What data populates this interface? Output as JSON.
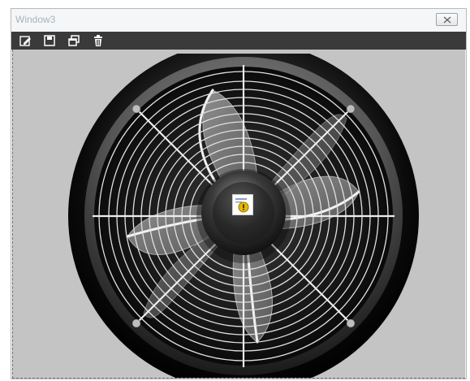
{
  "window": {
    "title": "Window3"
  },
  "icons": {
    "close": "close-icon",
    "edit": "edit-icon",
    "save": "save-icon",
    "restore": "restore-window-icon",
    "delete": "trash-icon",
    "fan": "fan-graphic",
    "hub_status": "warning-status-icon"
  },
  "colors": {
    "toolbar_bg": "#3a3a3a",
    "canvas_bg": "#c4c4c4",
    "title_text": "#a8b3c0",
    "warning": "#e8b800"
  }
}
